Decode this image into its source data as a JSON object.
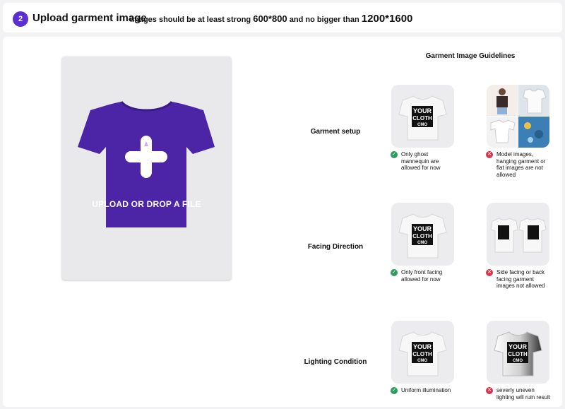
{
  "header": {
    "step": "2",
    "title": "Upload garment image",
    "hint_text": "images should be at least strong",
    "min_size": "600*800",
    "hint_mid": "and no bigger than",
    "max_size": "1200*1600"
  },
  "upload": {
    "label": "UPLOAD OR DROP A FILE",
    "icon": "plus-icon",
    "preview_color": "#4b25a6"
  },
  "guidelines": {
    "title": "Garment Image Guidelines",
    "rows": [
      {
        "label": "Garment setup",
        "good": "Only ghost mannequin are allowed for now",
        "bad": "Model images, hanging garment or flat images are not allowed"
      },
      {
        "label": "Facing Direction",
        "good": "Only front facing allowed for now",
        "bad": "Side facing or back facing garment images not allowed"
      },
      {
        "label": "Lighting Condition",
        "good": "Uniform illumination",
        "bad": "severly uneven lighting will ruin result"
      }
    ]
  },
  "shirt_print": {
    "line1": "YOUR",
    "line2": "CLOTH",
    "line3": "CMO"
  },
  "colors": {
    "accent": "#5b2fd1",
    "ok": "#2e9b5f",
    "bad": "#d4384f"
  }
}
